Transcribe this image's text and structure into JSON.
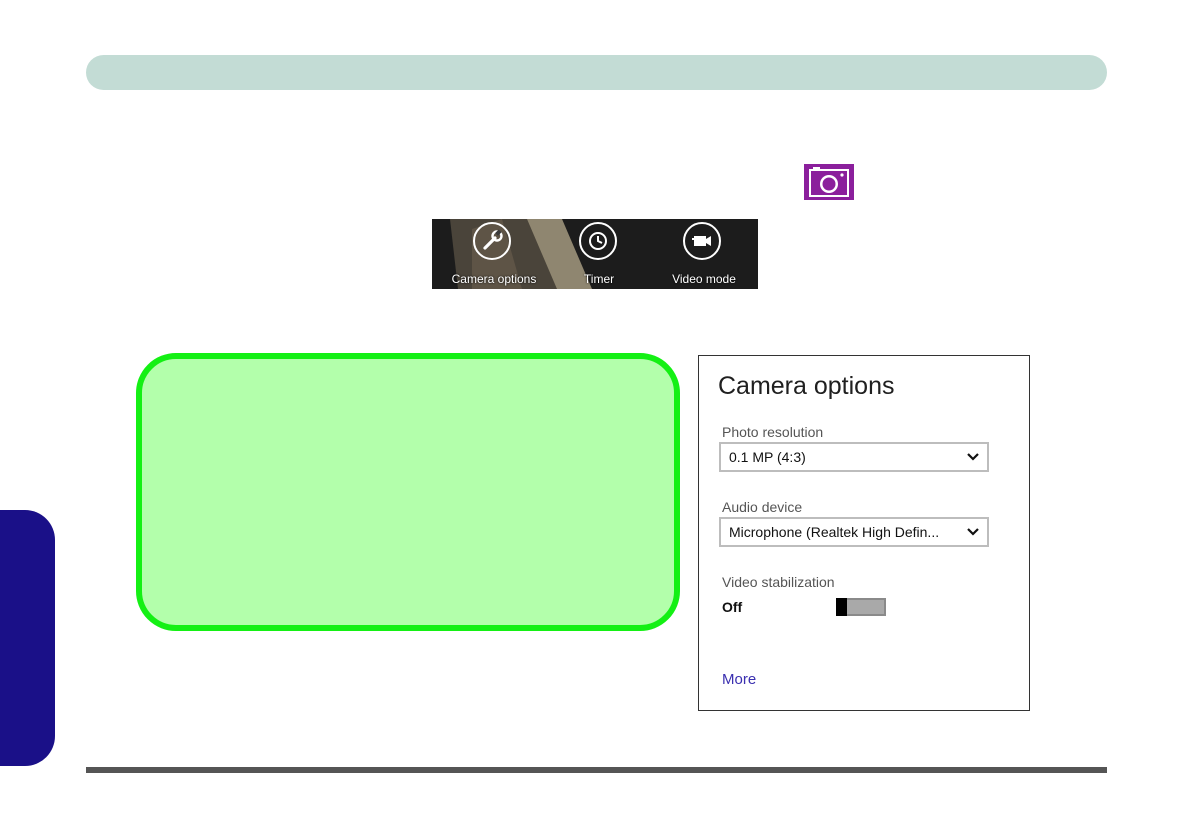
{
  "colors": {
    "header_bar": "#c3dcd5",
    "side_tab": "#1a1088",
    "note_fill": "#b3ffab",
    "note_border": "#14f014",
    "camera_icon": "#8b1f9c",
    "link": "#3a2fb0"
  },
  "camera_app_icon": {
    "icon": "camera-icon"
  },
  "app_bar": {
    "buttons": [
      {
        "icon": "wrench-icon",
        "label": "Camera options"
      },
      {
        "icon": "clock-icon",
        "label": "Timer"
      },
      {
        "icon": "video-camera-icon",
        "label": "Video mode"
      }
    ]
  },
  "camera_options_panel": {
    "title": "Camera options",
    "photo_resolution": {
      "label": "Photo resolution",
      "value": "0.1 MP (4:3)"
    },
    "audio_device": {
      "label": "Audio device",
      "value": "Microphone (Realtek High Defin..."
    },
    "video_stabilization": {
      "label": "Video stabilization",
      "state": "Off",
      "on": false
    },
    "more_link": "More"
  }
}
